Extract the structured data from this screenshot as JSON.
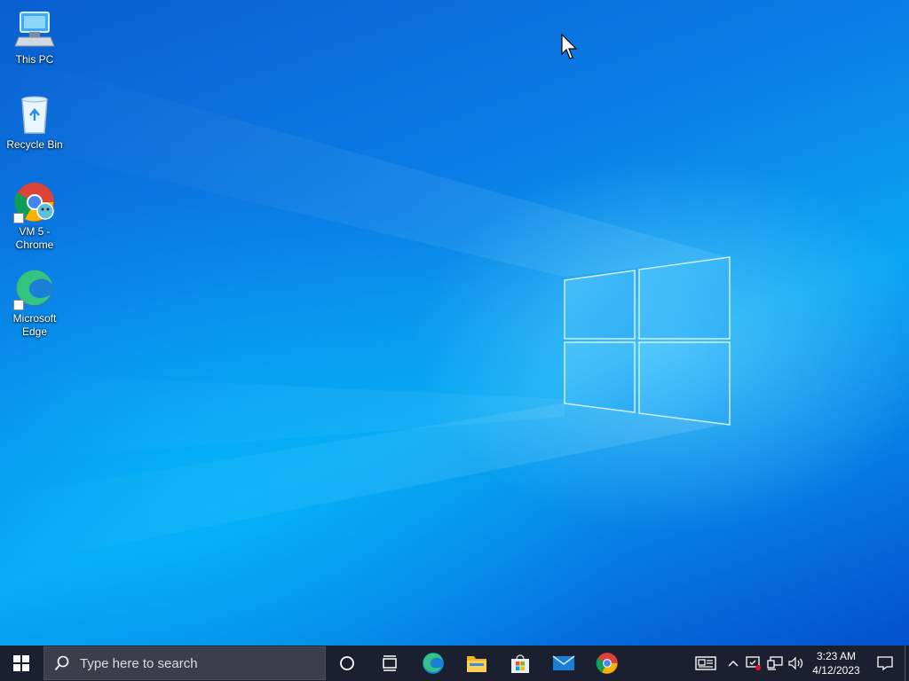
{
  "desktop": {
    "icons": [
      {
        "label": "This PC"
      },
      {
        "label": "Recycle Bin"
      },
      {
        "label": "VM 5 - Chrome"
      },
      {
        "label": "Microsoft Edge"
      }
    ]
  },
  "taskbar": {
    "search_placeholder": "Type here to search",
    "pinned_apps": [
      "Microsoft Edge",
      "File Explorer",
      "Microsoft Store",
      "Mail",
      "Google Chrome"
    ],
    "clock": {
      "time": "3:23 AM",
      "date": "4/12/2023"
    }
  },
  "colors": {
    "taskbar_bg": "#1b2030",
    "search_bg": "#3a3f4b",
    "desktop_accent": "#0a7ee6"
  }
}
